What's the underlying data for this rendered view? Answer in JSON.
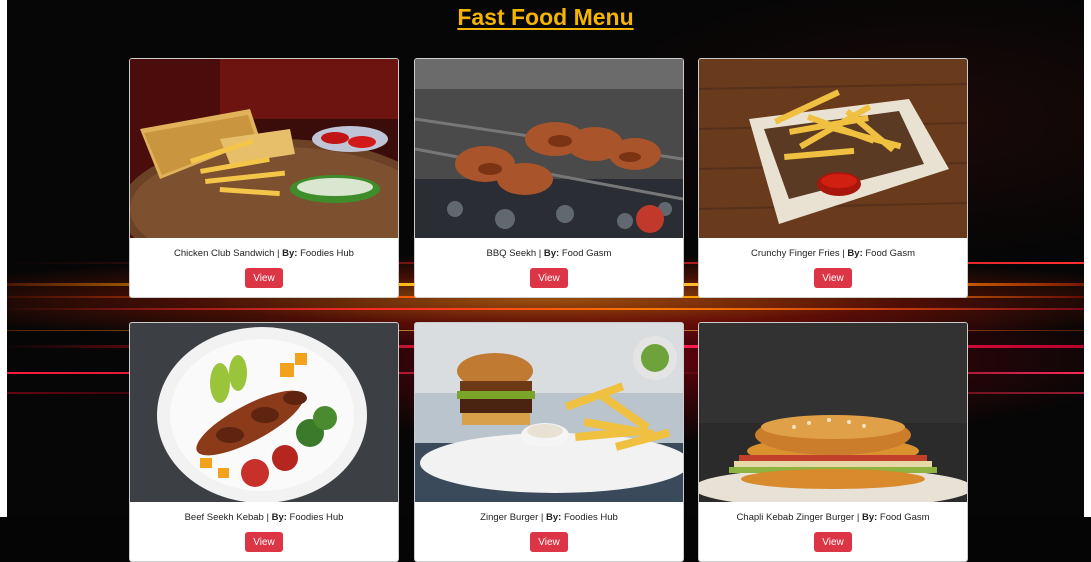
{
  "page": {
    "title": "Fast Food Menu"
  },
  "menu": {
    "by_label": "By:",
    "separator": " | ",
    "items": [
      {
        "name": "Chicken Club Sandwich",
        "vendor": "Foodies Hub",
        "button_label": "View"
      },
      {
        "name": "BBQ Seekh",
        "vendor": "Food Gasm",
        "button_label": "View"
      },
      {
        "name": "Crunchy Finger Fries",
        "vendor": "Food Gasm",
        "button_label": "View"
      },
      {
        "name": "Beef Seekh Kebab",
        "vendor": "Foodies Hub",
        "button_label": "View"
      },
      {
        "name": "Zinger Burger",
        "vendor": "Foodies Hub",
        "button_label": "View"
      },
      {
        "name": "Chapli Kebab Zinger Burger",
        "vendor": "Food Gasm",
        "button_label": "View"
      }
    ]
  },
  "colors": {
    "title": "#f4b400",
    "button": "#dc3545",
    "card_background": "#ffffff",
    "page_background": "#050505"
  }
}
